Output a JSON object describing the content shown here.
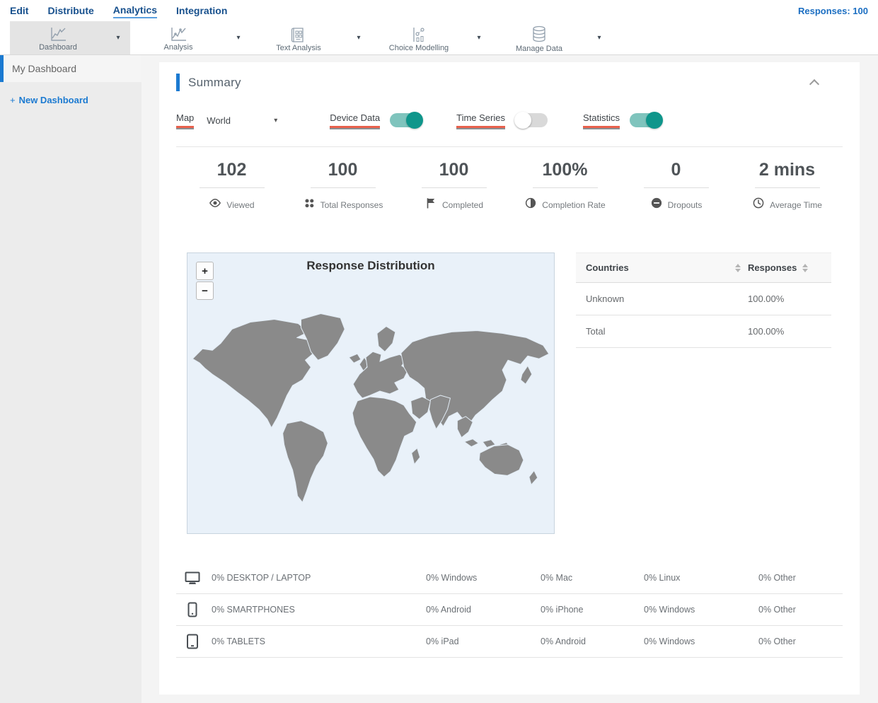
{
  "nav": {
    "items": [
      {
        "label": "Edit"
      },
      {
        "label": "Distribute"
      },
      {
        "label": "Analytics"
      },
      {
        "label": "Integration"
      }
    ],
    "responses": "Responses: 100"
  },
  "toolbar": {
    "items": [
      {
        "label": "Dashboard",
        "icon": "line-chart-icon"
      },
      {
        "label": "Analysis",
        "icon": "line-chart-icon"
      },
      {
        "label": "Text Analysis",
        "icon": "document-grid-icon"
      },
      {
        "label": "Choice Modelling",
        "icon": "scatter-chart-icon"
      },
      {
        "label": "Manage Data",
        "icon": "database-icon"
      }
    ]
  },
  "sidebar": {
    "active_item": "My Dashboard",
    "new_dashboard": {
      "plus": "+",
      "label": "New Dashboard"
    }
  },
  "summary": {
    "title": "Summary",
    "controls": {
      "map_label": "Map",
      "map_value": "World",
      "toggles": [
        {
          "label": "Device Data",
          "on": true
        },
        {
          "label": "Time Series",
          "on": false
        },
        {
          "label": "Statistics",
          "on": true
        }
      ]
    },
    "stats": [
      {
        "value": "102",
        "label": "Viewed",
        "icon": "eye-icon"
      },
      {
        "value": "100",
        "label": "Total Responses",
        "icon": "dots-icon"
      },
      {
        "value": "100",
        "label": "Completed",
        "icon": "flag-icon"
      },
      {
        "value": "100%",
        "label": "Completion Rate",
        "icon": "contrast-icon"
      },
      {
        "value": "0",
        "label": "Dropouts",
        "icon": "minus-circle-icon"
      },
      {
        "value": "2 mins",
        "label": "Average Time",
        "icon": "clock-icon"
      }
    ],
    "map": {
      "title": "Response Distribution",
      "zoom_in": "+",
      "zoom_out": "−"
    },
    "countries_table": {
      "headers": [
        "Countries",
        "Responses"
      ],
      "rows": [
        {
          "country": "Unknown",
          "responses": "100.00%"
        },
        {
          "country": "Total",
          "responses": "100.00%"
        }
      ]
    },
    "device_table": {
      "rows": [
        {
          "icon": "desktop-icon",
          "label": "0% DESKTOP / LAPTOP",
          "cells": [
            "0% Windows",
            "0% Mac",
            "0% Linux",
            "0% Other"
          ]
        },
        {
          "icon": "smartphone-icon",
          "label": "0% SMARTPHONES",
          "cells": [
            "0% Android",
            "0% iPhone",
            "0% Windows",
            "0% Other"
          ]
        },
        {
          "icon": "tablet-icon",
          "label": "0% TABLETS",
          "cells": [
            "0% iPad",
            "0% Android",
            "0% Windows",
            "0% Other"
          ]
        }
      ]
    }
  },
  "colors": {
    "nav_text": "#17508d",
    "accent_blue": "#1b7ad1",
    "toggle_on_knob": "#0f968b",
    "toggle_on_track": "#7fc4bd",
    "underline_red": "#e8604c",
    "map_bg": "#e9f1f9",
    "map_land": "#8a8a8a"
  }
}
